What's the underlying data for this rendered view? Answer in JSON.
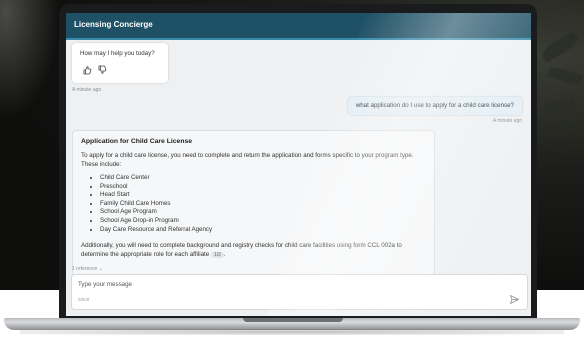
{
  "app": {
    "title": "Licensing Concierge"
  },
  "messages": {
    "greeting": "How may I help you today?",
    "greeting_time": "A minute ago",
    "user_question": "what application do I use to apply for a child care license?",
    "user_time": "A minute ago",
    "answer": {
      "title": "Application for Child Care License",
      "intro": "To apply for a child care license, you need to complete and return the application and forms specific to your program type. These include:",
      "items": [
        "Child Care Center",
        "Preschool",
        "Head Start",
        "Family Child Care Homes",
        "School Age Program",
        "School Age Drop-in Program",
        "Day Care Resource and Referral Agency"
      ],
      "outro": "Additionally, you will need to complete background and registry checks for child care facilities using form CCL 002a to determine the appropriate role for each affiliate",
      "citation": "1/2",
      "references": "1 reference ⌄"
    }
  },
  "composer": {
    "placeholder": "Type your message",
    "counter": "0/500"
  },
  "icons": {
    "thumb_up": "thumbs-up-icon",
    "thumb_down": "thumbs-down-icon",
    "send": "send-icon"
  },
  "colors": {
    "header": "#1f5166",
    "header_accent": "#3a8bab",
    "user_bubble": "#e3eef5"
  }
}
